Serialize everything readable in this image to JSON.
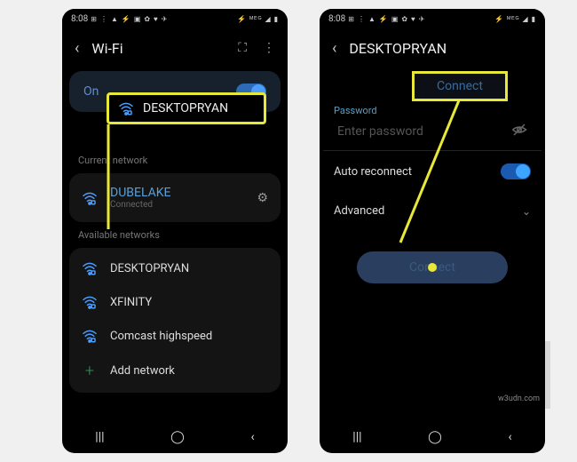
{
  "status": {
    "time": "8:08",
    "icons_left": "⊞ ⋮ ▲ ⚡ ▣ ✿ ♥ ✈",
    "icons_right": "⚡ ᴹᴱᴳ ◢ ▮"
  },
  "left": {
    "title": "Wi-Fi",
    "on_label": "On",
    "callout_network": "DESKTOPRYAN",
    "current_label": "Current network",
    "current_name": "DUBELAKE",
    "current_status": "Connected",
    "available_label": "Available networks",
    "networks": [
      "DESKTOPRYAN",
      "XFINITY",
      "Comcast highspeed"
    ],
    "add_label": "Add network"
  },
  "right": {
    "title": "DESKTOPRYAN",
    "password_label": "Password",
    "password_placeholder": "Enter password",
    "auto_reconnect": "Auto reconnect",
    "advanced": "Advanced",
    "connect_callout": "Connect",
    "connect_btn": "Connect"
  },
  "watermark": "w3udn.com"
}
